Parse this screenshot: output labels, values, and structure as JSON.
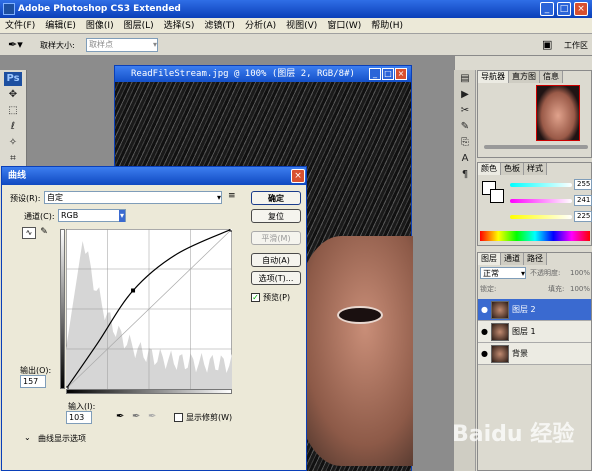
{
  "app": {
    "title": "Adobe Photoshop CS3 Extended"
  },
  "menu": [
    "文件(F)",
    "编辑(E)",
    "图像(I)",
    "图层(L)",
    "选择(S)",
    "滤镜(T)",
    "分析(A)",
    "视图(V)",
    "窗口(W)",
    "帮助(H)"
  ],
  "options": {
    "sample_label": "取样大小:",
    "sample_value": "取样点",
    "workspace": "工作区"
  },
  "document": {
    "title": "ReadFileStream.jpg @ 100% (图层 2, RGB/8#)"
  },
  "curves": {
    "title": "曲线",
    "preset_label": "预设(R):",
    "preset_value": "自定",
    "channel_label": "通道(C):",
    "channel_value": "RGB",
    "output_label": "输出(O):",
    "output_value": "157",
    "input_label": "输入(I):",
    "input_value": "103",
    "show_clipping": "显示修剪(W)",
    "display_options": "曲线显示选项",
    "buttons": {
      "ok": "确定",
      "reset": "复位",
      "smooth": "平滑(M)",
      "auto": "自动(A)",
      "options": "选项(T)..."
    },
    "preview_label": "预览(P)",
    "preview_checked": true
  },
  "panels": {
    "nav_tabs": [
      "导航器",
      "直方图",
      "信息"
    ],
    "color_tabs": [
      "颜色",
      "色板",
      "样式"
    ],
    "color_values": {
      "r": "255",
      "g": "241",
      "b": "225"
    },
    "layer_tabs": [
      "图层",
      "通道",
      "路径"
    ],
    "blend_mode": "正常",
    "opacity_label": "不透明度:",
    "opacity_value": "100%",
    "fill_label": "填充:",
    "fill_value": "100%",
    "lock_label": "锁定:",
    "layers": [
      {
        "name": "图层 2",
        "active": true
      },
      {
        "name": "图层 1",
        "active": false
      },
      {
        "name": "背景",
        "active": false
      }
    ]
  },
  "chart_data": {
    "type": "line",
    "title": "",
    "xlabel": "输入",
    "ylabel": "输出",
    "xlim": [
      0,
      255
    ],
    "ylim": [
      0,
      255
    ],
    "series": [
      {
        "values_x": [
          0,
          48,
          103,
          170,
          255
        ],
        "values_y": [
          0,
          72,
          157,
          215,
          255
        ]
      }
    ],
    "control_point": {
      "x": 103,
      "y": 157
    }
  },
  "watermark": "Baidu 经验"
}
